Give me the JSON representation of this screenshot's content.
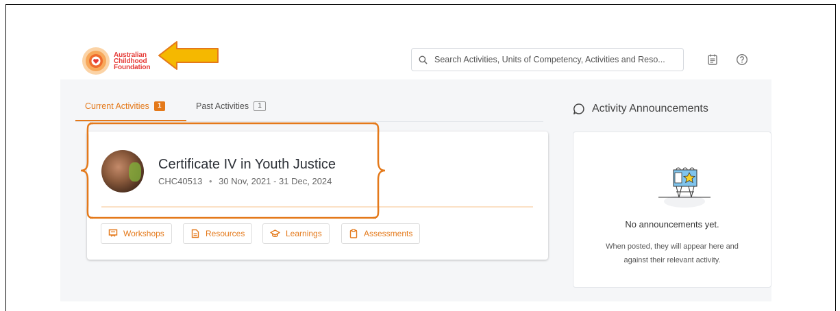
{
  "header": {
    "logo_line1": "Australian",
    "logo_line2": "Childhood",
    "logo_line3": "Foundation",
    "search_placeholder": "Search Activities, Units of Competency, Activities and Reso...",
    "icons": [
      "search-icon",
      "calendar-icon",
      "help-icon"
    ]
  },
  "tabs": [
    {
      "label": "Current Activities",
      "count": "1",
      "active": true
    },
    {
      "label": "Past Activities",
      "count": "1",
      "active": false
    }
  ],
  "course": {
    "title": "Certificate IV in Youth Justice",
    "code": "CHC40513",
    "separator": "•",
    "dates": "30 Nov, 2021 - 31 Dec, 2024"
  },
  "actions": [
    {
      "label": "Workshops",
      "icon": "presentation-icon"
    },
    {
      "label": "Resources",
      "icon": "document-icon"
    },
    {
      "label": "Learnings",
      "icon": "graduation-cap-icon"
    },
    {
      "label": "Assessments",
      "icon": "clipboard-icon"
    }
  ],
  "announcements": {
    "heading": "Activity Announcements",
    "empty_title": "No announcements yet.",
    "empty_line1": "When posted, they will appear here and",
    "empty_line2": "against their relevant activity."
  },
  "colors": {
    "accent": "#e4791a",
    "annotation_arrow": "#f5b800",
    "annotation_outline": "#e4791a"
  }
}
